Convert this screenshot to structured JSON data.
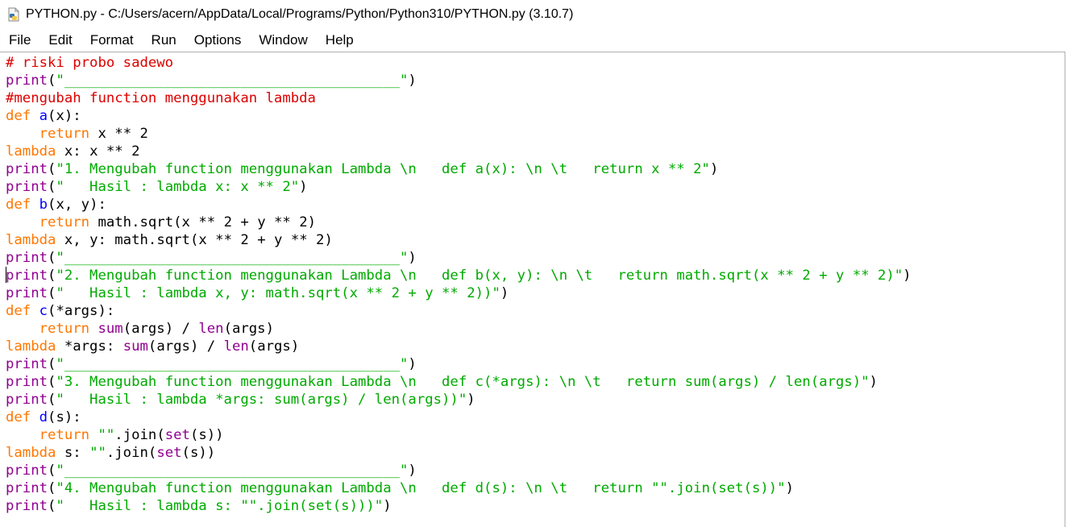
{
  "window": {
    "title": "PYTHON.py - C:/Users/acern/AppData/Local/Programs/Python/Python310/PYTHON.py (3.10.7)",
    "icon": "python-file-icon"
  },
  "menu": [
    "File",
    "Edit",
    "Format",
    "Run",
    "Options",
    "Window",
    "Help"
  ],
  "editor": {
    "lines": [
      "# riski probo sadewo",
      "print(\"________________________________________\")",
      "#mengubah function menggunakan lambda",
      "def a(x):",
      "    return x ** 2",
      "lambda x: x ** 2",
      "print(\"1. Mengubah function menggunakan Lambda \\n   def a(x): \\n \\t   return x ** 2\")",
      "print(\"   Hasil : lambda x: x ** 2\")",
      "def b(x, y):",
      "    return math.sqrt(x ** 2 + y ** 2)",
      "lambda x, y: math.sqrt(x ** 2 + y ** 2)",
      "print(\"________________________________________\")",
      "print(\"2. Mengubah function menggunakan Lambda \\n   def b(x, y): \\n \\t   return math.sqrt(x ** 2 + y ** 2)\")",
      "print(\"   Hasil : lambda x, y: math.sqrt(x ** 2 + y ** 2))\")",
      "def c(*args):",
      "    return sum(args) / len(args)",
      "lambda *args: sum(args) / len(args)",
      "print(\"________________________________________\")",
      "print(\"3. Mengubah function menggunakan Lambda \\n   def c(*args): \\n \\t   return sum(args) / len(args)\")",
      "print(\"   Hasil : lambda *args: sum(args) / len(args))\")",
      "def d(s):",
      "    return \"\".join(set(s))",
      "lambda s: \"\".join(set(s))",
      "print(\"________________________________________\")",
      "print(\"4. Mengubah function menggunakan Lambda \\n   def d(s): \\n \\t   return \"\".join(set(s))\")",
      "print(\"   Hasil : lambda s: \"\".join(set(s)))\")"
    ]
  },
  "colors": {
    "comment": "#dd0000",
    "keyword": "#ff7700",
    "builtin": "#900090",
    "string": "#00aa00",
    "definition": "#0000ff"
  }
}
